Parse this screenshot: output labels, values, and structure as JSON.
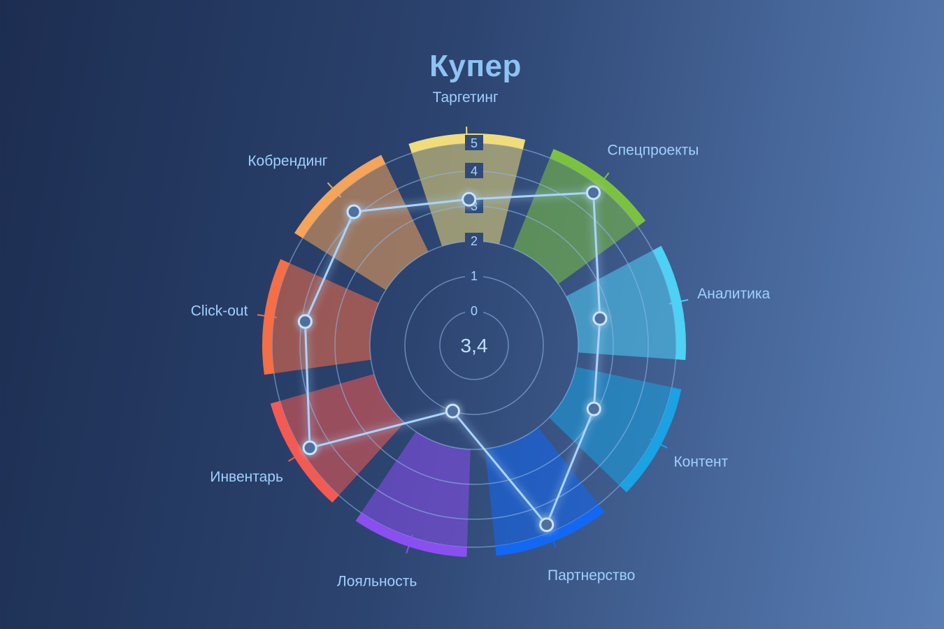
{
  "chart_data": {
    "type": "radar",
    "title": "Купер",
    "center_value": "3,4",
    "radial_ticks": [
      "0",
      "1",
      "2",
      "3",
      "4",
      "5"
    ],
    "rmax": 5,
    "categories": [
      {
        "label": "Спецпроекты",
        "value": 4.7,
        "color": "#7dc23f"
      },
      {
        "label": "Аналитика",
        "value": 2.7,
        "color": "#4fd0f5"
      },
      {
        "label": "Контент",
        "value": 2.9,
        "color": "#1aa2e2"
      },
      {
        "label": "Партнерство",
        "value": 4.7,
        "color": "#1268f2"
      },
      {
        "label": "Лояльность",
        "value": 1.0,
        "color": "#8a4ff0"
      },
      {
        "label": "Инвентарь",
        "value": 4.7,
        "color": "#f45a52"
      },
      {
        "label": "Click-out",
        "value": 3.9,
        "color": "#f56e45"
      },
      {
        "label": "Кобрендинг",
        "value": 4.2,
        "color": "#f5a45a"
      },
      {
        "label": "Таргетинг",
        "value": 3.2,
        "color": "#f0dc7a"
      }
    ]
  }
}
